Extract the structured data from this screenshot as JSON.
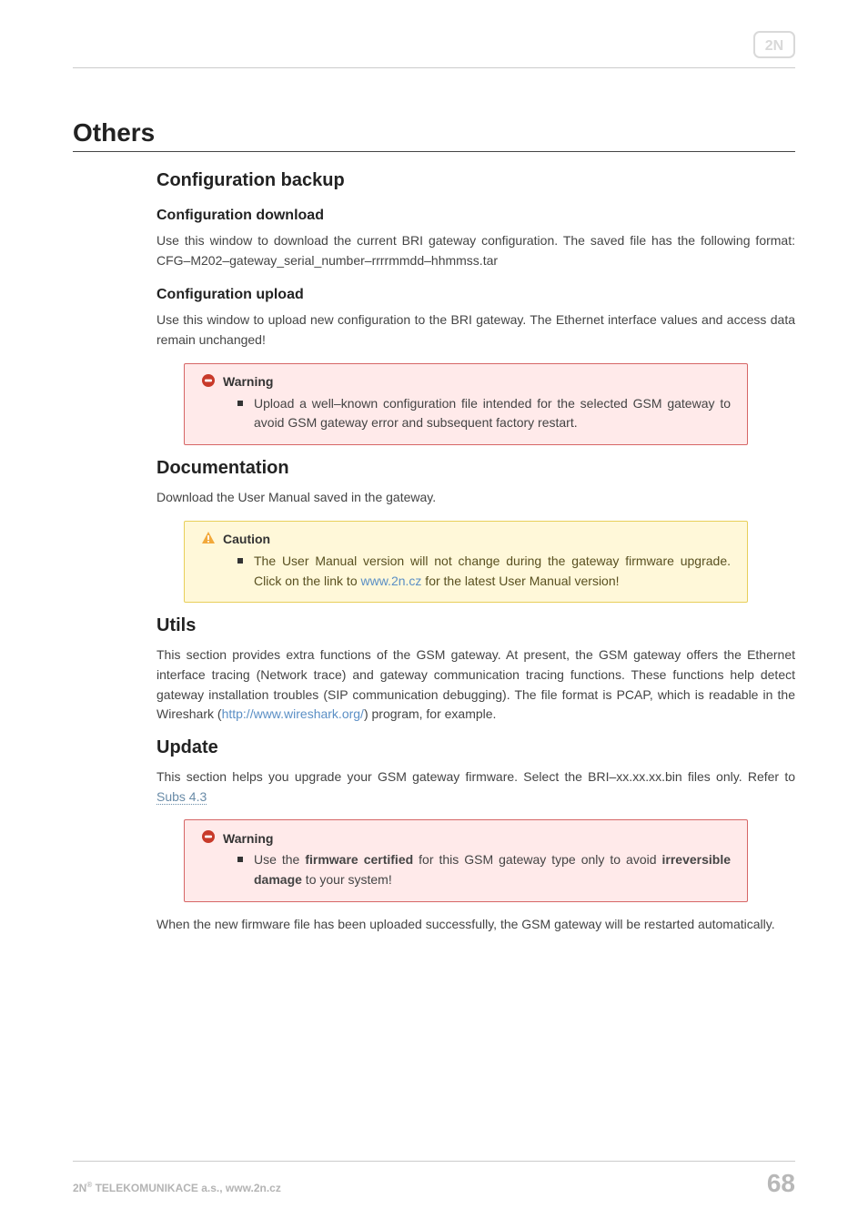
{
  "logo": {
    "name": "2N"
  },
  "h1": "Others",
  "sections": {
    "config_backup": {
      "title": "Configuration backup",
      "download": {
        "title": "Configuration download",
        "body": "Use this window to download the current BRI gateway configuration. The saved file has the following format: CFG–M202–gateway_serial_number–rrrrmmdd–hhmmss.tar"
      },
      "upload": {
        "title": "Configuration upload",
        "body": "Use this window to upload new configuration to the BRI gateway. The Ethernet interface values and access data remain unchanged!",
        "warning": {
          "label": "Warning",
          "item": "Upload a well–known configuration file intended for the selected GSM gateway to avoid GSM gateway error and subsequent factory restart."
        }
      }
    },
    "documentation": {
      "title": "Documentation",
      "body": "Download the User Manual saved in the gateway.",
      "caution": {
        "label": "Caution",
        "item_pre": "The User Manual version will not change during the gateway firmware upgrade. Click on the link to ",
        "link_text": "www.2n.cz",
        "item_post": " for the latest User Manual version!"
      }
    },
    "utils": {
      "title": "Utils",
      "body_pre": "This section provides extra functions of the GSM gateway. At present, the GSM gateway offers the Ethernet interface tracing (Network trace) and gateway communication tracing functions. These functions help detect gateway installation troubles (SIP communication debugging). The file format is PCAP, which is readable in the Wireshark (",
      "link_text": "http://www.wireshark.org/",
      "body_post": ") program, for example."
    },
    "update": {
      "title": "Update",
      "body_pre": "This section helps you upgrade your GSM gateway firmware. Select the BRI–xx.xx.xx.bin files only. Refer to",
      "link_text": " Subs 4.3 ",
      "warning": {
        "label": "Warning",
        "item_pre": "Use the ",
        "bold1": "firmware certified",
        "item_mid": " for this GSM gateway type only to avoid ",
        "bold2": "irreversible damage",
        "item_post": " to your system!"
      },
      "body_after": "When the new firmware file has been uploaded successfully, the GSM gateway will be restarted automatically."
    }
  },
  "footer": {
    "company_pre": "2N",
    "reg": "®",
    "company_post": " TELEKOMUNIKACE a.s., www.2n.cz",
    "page": "68"
  }
}
